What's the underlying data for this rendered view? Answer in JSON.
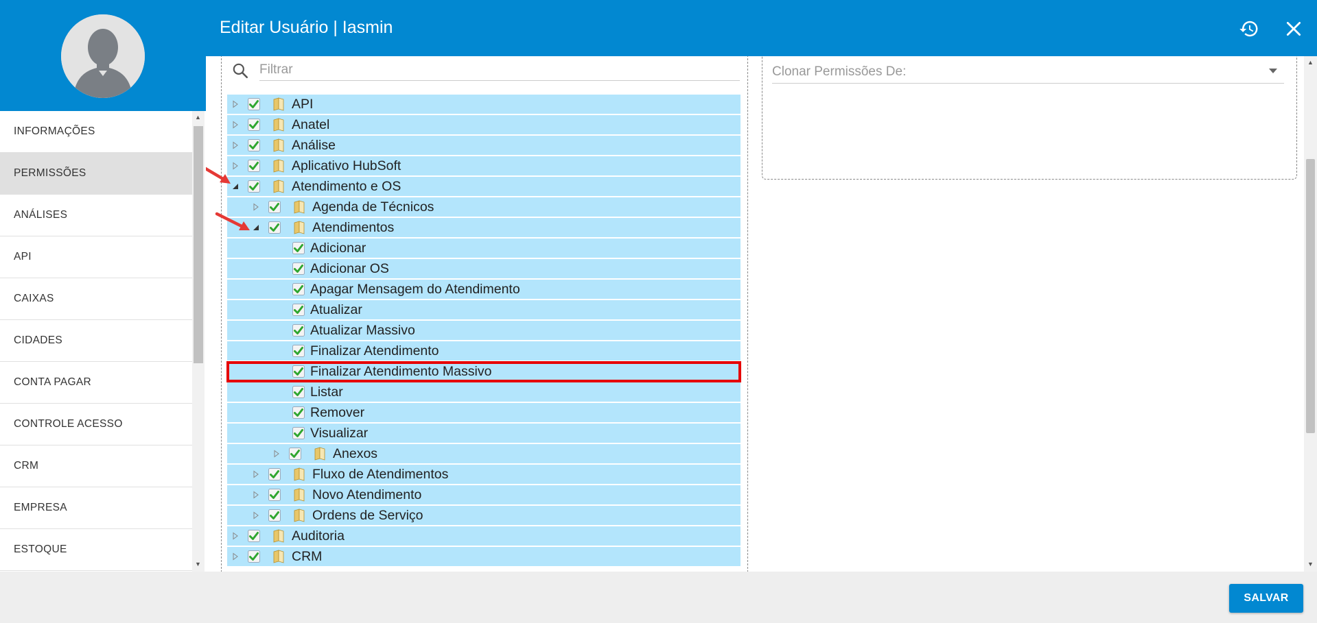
{
  "header": {
    "title": "Editar Usuário | Iasmin",
    "history_icon": "history-icon",
    "close_icon": "close-icon",
    "color": "#0288d1"
  },
  "sidebar": {
    "items": [
      {
        "label": "INFORMAÇÕES",
        "active": false
      },
      {
        "label": "PERMISSÕES",
        "active": true
      },
      {
        "label": "ANÁLISES",
        "active": false
      },
      {
        "label": "API",
        "active": false
      },
      {
        "label": "CAIXAS",
        "active": false
      },
      {
        "label": "CIDADES",
        "active": false
      },
      {
        "label": "CONTA PAGAR",
        "active": false
      },
      {
        "label": "CONTROLE ACESSO",
        "active": false
      },
      {
        "label": "CRM",
        "active": false
      },
      {
        "label": "EMPRESA",
        "active": false
      },
      {
        "label": "ESTOQUE",
        "active": false
      }
    ]
  },
  "permissions": {
    "filter_placeholder": "Filtrar",
    "clone_placeholder": "Clonar Permissões De:",
    "tree": [
      {
        "label": "API",
        "level": 0,
        "folder": true,
        "expanded": false,
        "checked": true
      },
      {
        "label": "Anatel",
        "level": 0,
        "folder": true,
        "expanded": false,
        "checked": true
      },
      {
        "label": "Análise",
        "level": 0,
        "folder": true,
        "expanded": false,
        "checked": true
      },
      {
        "label": "Aplicativo HubSoft",
        "level": 0,
        "folder": true,
        "expanded": false,
        "checked": true
      },
      {
        "label": "Atendimento e OS",
        "level": 0,
        "folder": true,
        "expanded": true,
        "checked": true
      },
      {
        "label": "Agenda de Técnicos",
        "level": 1,
        "folder": true,
        "expanded": false,
        "checked": true
      },
      {
        "label": "Atendimentos",
        "level": 1,
        "folder": true,
        "expanded": true,
        "checked": true
      },
      {
        "label": "Adicionar",
        "level": 2,
        "folder": false,
        "checked": true
      },
      {
        "label": "Adicionar OS",
        "level": 2,
        "folder": false,
        "checked": true
      },
      {
        "label": "Apagar Mensagem do Atendimento",
        "level": 2,
        "folder": false,
        "checked": true
      },
      {
        "label": "Atualizar",
        "level": 2,
        "folder": false,
        "checked": true
      },
      {
        "label": "Atualizar Massivo",
        "level": 2,
        "folder": false,
        "checked": true
      },
      {
        "label": "Finalizar Atendimento",
        "level": 2,
        "folder": false,
        "checked": true
      },
      {
        "label": "Finalizar Atendimento Massivo",
        "level": 2,
        "folder": false,
        "checked": true,
        "highlighted": true
      },
      {
        "label": "Listar",
        "level": 2,
        "folder": false,
        "checked": true
      },
      {
        "label": "Remover",
        "level": 2,
        "folder": false,
        "checked": true
      },
      {
        "label": "Visualizar",
        "level": 2,
        "folder": false,
        "checked": true
      },
      {
        "label": "Anexos",
        "level": 2,
        "folder": true,
        "expanded": false,
        "checked": true
      },
      {
        "label": "Fluxo de Atendimentos",
        "level": 1,
        "folder": true,
        "expanded": false,
        "checked": true
      },
      {
        "label": "Novo Atendimento",
        "level": 1,
        "folder": true,
        "expanded": false,
        "checked": true
      },
      {
        "label": "Ordens de Serviço",
        "level": 1,
        "folder": true,
        "expanded": false,
        "checked": true
      },
      {
        "label": "Auditoria",
        "level": 0,
        "folder": true,
        "expanded": false,
        "checked": true
      },
      {
        "label": "CRM",
        "level": 0,
        "folder": true,
        "expanded": false,
        "checked": true
      }
    ]
  },
  "footer": {
    "save_label": "SALVAR"
  }
}
